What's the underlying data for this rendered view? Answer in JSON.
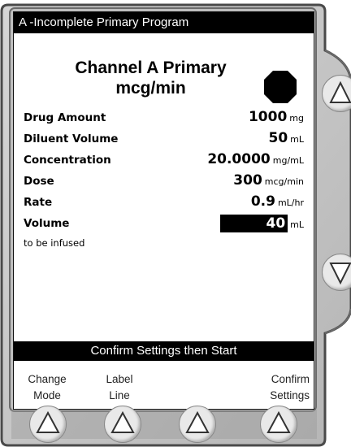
{
  "title_bar": "A -Incomplete Primary Program",
  "heading": {
    "line1": "Channel A Primary",
    "line2": "mcg/min"
  },
  "rows": [
    {
      "label": "Drug Amount",
      "value": "1000",
      "unit": "mg"
    },
    {
      "label": "Diluent Volume",
      "value": "50",
      "unit": "mL"
    },
    {
      "label": "Concentration",
      "value": "20.0000",
      "unit": "mg/mL"
    },
    {
      "label": "Dose",
      "value": "300",
      "unit": "mcg/min"
    },
    {
      "label": "Rate",
      "value": "0.9",
      "unit": "mL/hr"
    },
    {
      "label": "Volume",
      "sublabel": "to be infused",
      "value": "40",
      "unit": "mL"
    }
  ],
  "bottom_bar": "Confirm Settings then Start",
  "softkeys": [
    {
      "line1": "Change",
      "line2": "Mode"
    },
    {
      "line1": "Label",
      "line2": "Line"
    },
    {
      "line1": "",
      "line2": ""
    },
    {
      "line1": "Confirm",
      "line2": "Settings"
    }
  ],
  "icons": {
    "stop": "stop-octagon-icon",
    "side_up": "arrow-up-icon",
    "side_down": "arrow-down-icon",
    "softkey": "arrow-up-icon"
  },
  "colors": {
    "bezel": "#c9c9c9",
    "bezel_edge": "#4a4a4a",
    "screen_bar": "#000000"
  }
}
